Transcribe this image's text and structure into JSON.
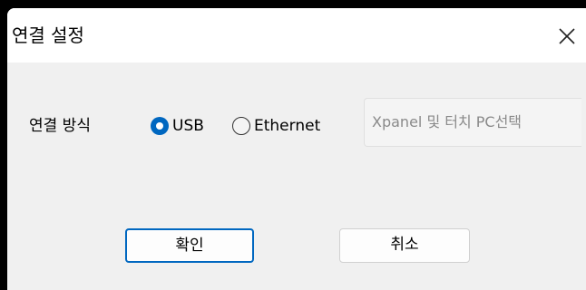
{
  "window": {
    "title": "연결 설정",
    "close_label": "×"
  },
  "connection": {
    "label": "연결 방식",
    "options": [
      {
        "label": "USB",
        "selected": true
      },
      {
        "label": "Ethernet",
        "selected": false
      }
    ],
    "device_select_placeholder": "Xpanel 및 터치 PC선택"
  },
  "buttons": {
    "ok_label": "확인",
    "cancel_label": "취소"
  },
  "colors": {
    "accent": "#0067c0",
    "dialog_bg": "#f0f0f0",
    "titlebar_bg": "#ffffff"
  },
  "icons": {
    "close": "close-icon"
  }
}
